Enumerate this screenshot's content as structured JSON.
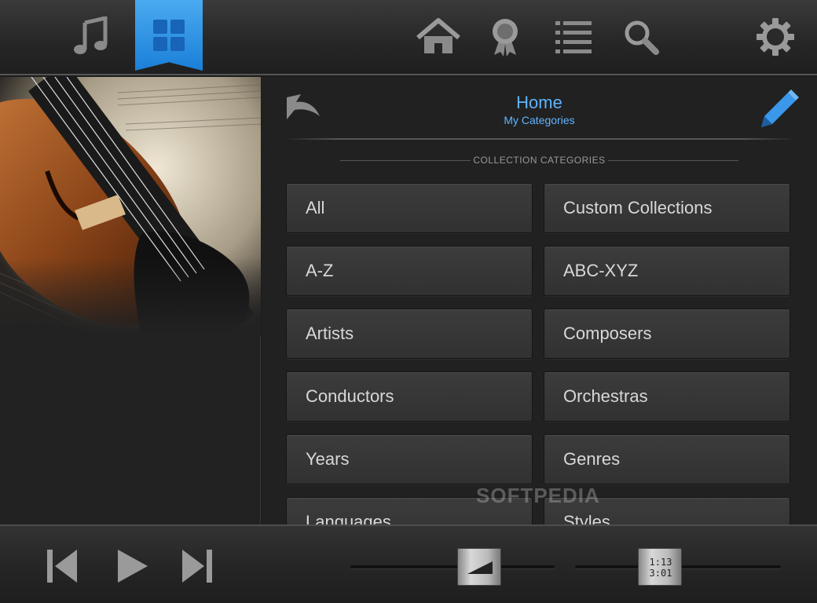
{
  "toolbar": {
    "tabs": [
      {
        "icon": "music-note-icon"
      },
      {
        "icon": "grid-icon",
        "active": true
      }
    ],
    "right_icons": [
      "home-icon",
      "award-icon",
      "list-icon",
      "search-icon",
      "gear-icon"
    ],
    "accent": "#2b8fe6"
  },
  "header": {
    "title": "Home",
    "subtitle": "My Categories",
    "back_icon": "back-arrow-icon",
    "edit_icon": "pencil-icon"
  },
  "section_label": "COLLECTION CATEGORIES",
  "categories": [
    "All",
    "Custom Collections",
    "A-Z",
    "ABC-XYZ",
    "Artists",
    "Composers",
    "Conductors",
    "Orchestras",
    "Years",
    "Genres",
    "Languages",
    "Styles"
  ],
  "watermark": "SOFTPEDIA",
  "transport": {
    "prev_icon": "skip-back-icon",
    "play_icon": "play-icon",
    "next_icon": "skip-forward-icon",
    "volume_icon": "volume-wedge-icon",
    "elapsed": "1:13",
    "total": "3:01"
  }
}
